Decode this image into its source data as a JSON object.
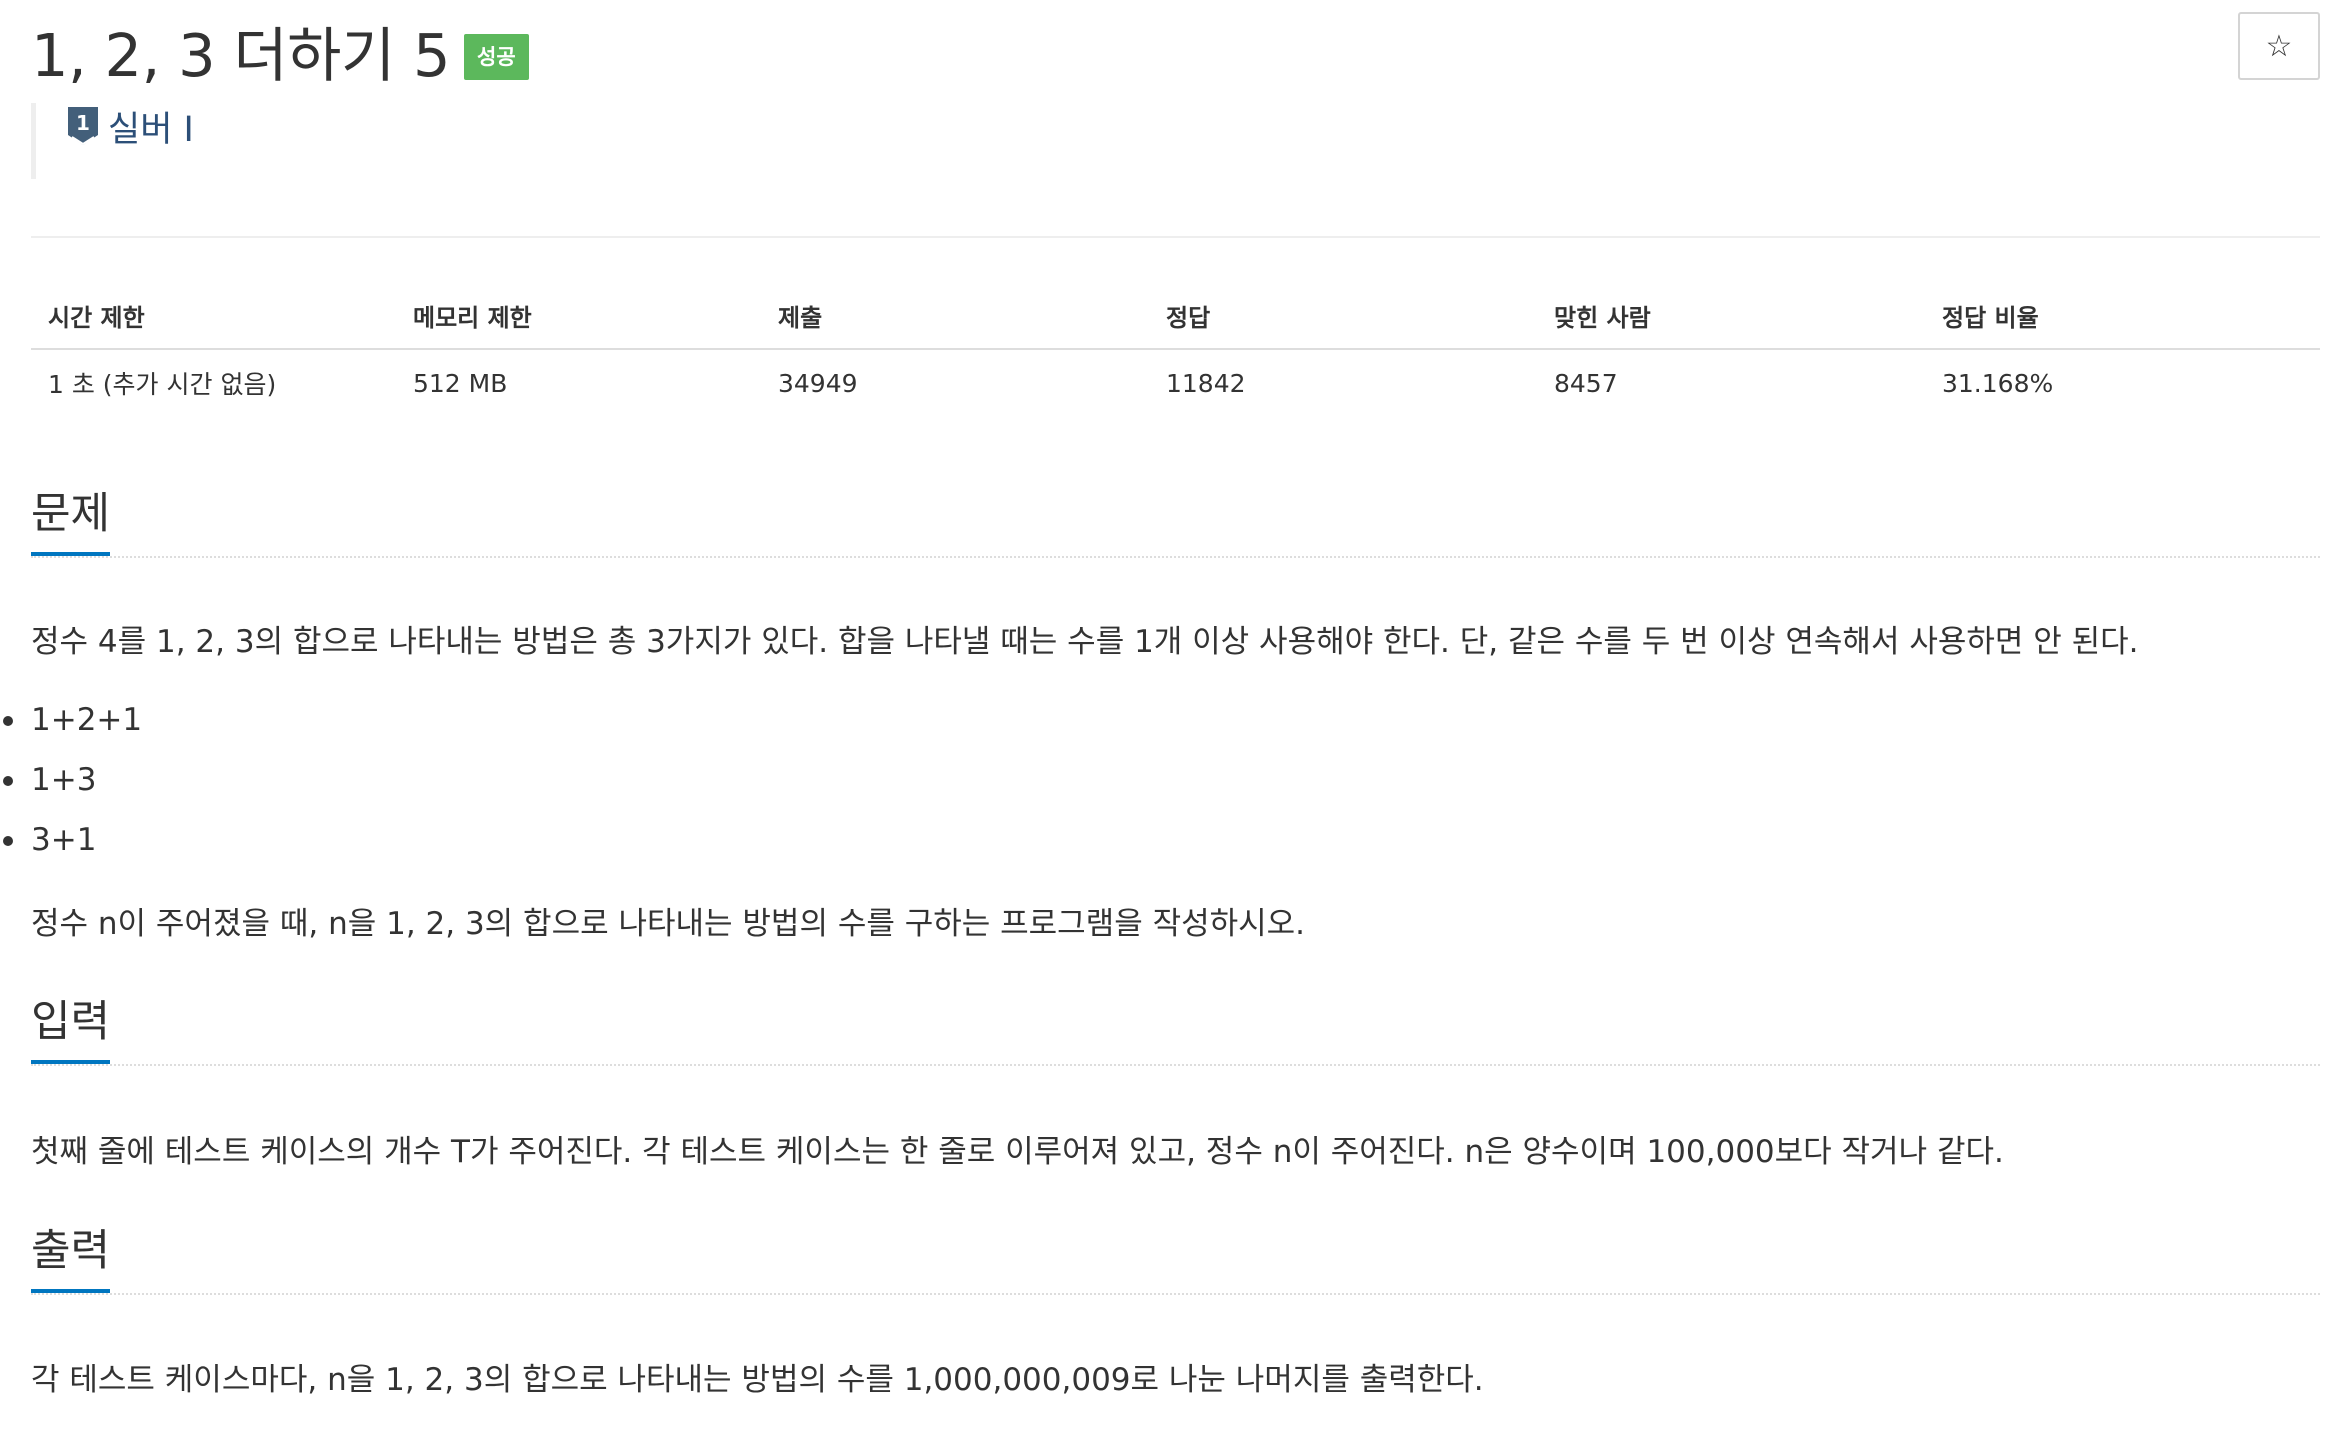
{
  "problem": {
    "title": "1, 2, 3 더하기 5",
    "result_badge": "성공",
    "star_glyph": "☆",
    "tier": {
      "number": "1",
      "label": "실버 I"
    }
  },
  "info_table": {
    "headers": [
      "시간 제한",
      "메모리 제한",
      "제출",
      "정답",
      "맞힌 사람",
      "정답 비율"
    ],
    "row": [
      "1 초 (추가 시간 없음)",
      "512 MB",
      "34949",
      "11842",
      "8457",
      "31.168%"
    ]
  },
  "sections": {
    "description": {
      "heading": "문제",
      "paragraph1": "정수 4를 1, 2, 3의 합으로 나타내는 방법은 총 3가지가 있다. 합을 나타낼 때는 수를 1개 이상 사용해야 한다. 단, 같은 수를 두 번 이상 연속해서 사용하면 안 된다.",
      "examples": [
        "1+2+1",
        "1+3",
        "3+1"
      ],
      "paragraph2": "정수 n이 주어졌을 때, n을 1, 2, 3의 합으로 나타내는 방법의 수를 구하는 프로그램을 작성하시오."
    },
    "input": {
      "heading": "입력",
      "paragraph": "첫째 줄에 테스트 케이스의 개수 T가 주어진다. 각 테스트 케이스는 한 줄로 이루어져 있고, 정수 n이 주어진다. n은 양수이며 100,000보다 작거나 같다."
    },
    "output": {
      "heading": "출력",
      "paragraph": "각 테스트 케이스마다, n을 1, 2, 3의 합으로 나타내는 방법의 수를 1,000,000,009로 나눈 나머지를 출력한다."
    }
  },
  "colors": {
    "badge_success": "#5cb85c",
    "tier_silver": "#435f7a",
    "section_underline": "#0076c0",
    "text": "#333333"
  },
  "icons": {
    "star": "star-icon",
    "tier": "silver-tier-icon"
  }
}
